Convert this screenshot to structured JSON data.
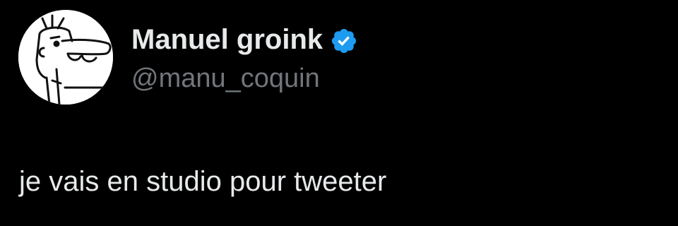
{
  "tweet": {
    "author": {
      "display_name": "Manuel groink",
      "handle": "@manu_coquin",
      "verified": true,
      "verified_badge_icon": "verified-badge-icon",
      "avatar_icon": "cartoon-face-avatar"
    },
    "text": "je vais en studio pour tweeter"
  },
  "colors": {
    "background": "#000000",
    "primary_text": "#e7e9ea",
    "secondary_text": "#71767b",
    "verified_blue": "#1d9bf0"
  }
}
